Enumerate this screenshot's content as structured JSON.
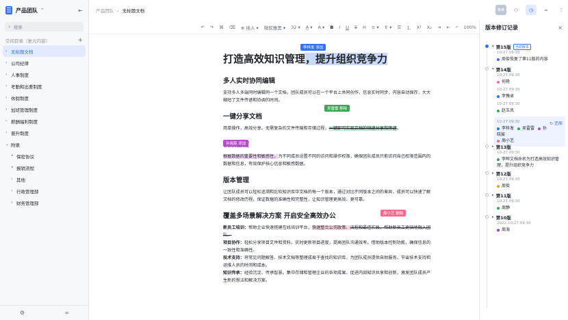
{
  "sidebar": {
    "team_name": "产品团队",
    "search_placeholder": "搜索",
    "section_title": "空间目录（复元内容）",
    "items": [
      {
        "label": "无标题文档",
        "active": true,
        "arrow": "›"
      },
      {
        "label": "公司纪律",
        "arrow": "›"
      },
      {
        "label": "人事制度",
        "arrow": "›"
      },
      {
        "label": "考勤和出差制度",
        "arrow": "›"
      },
      {
        "label": "休假制度",
        "arrow": "›"
      },
      {
        "label": "加班管理制度",
        "arrow": "›"
      },
      {
        "label": "薪酬福利制度",
        "arrow": "›"
      },
      {
        "label": "晋升制度",
        "arrow": "›"
      },
      {
        "label": "附录",
        "arrow": "⌄"
      },
      {
        "label": "保密协议",
        "child": true,
        "arrow": "•"
      },
      {
        "label": "报销流程",
        "child": true,
        "arrow": "•"
      },
      {
        "label": "其他",
        "child": true,
        "arrow": "›"
      },
      {
        "label": "行政管理部",
        "child": true,
        "arrow": "›"
      },
      {
        "label": "财务管理部",
        "child": true,
        "arrow": "›"
      }
    ]
  },
  "topbar": {
    "crumb_parent": "产品团队",
    "crumb_sep": "›",
    "crumb_current": "无标题文档",
    "avatar_text": "某某"
  },
  "toolbar": {
    "insert": "插入",
    "font": "微软雅黑",
    "size": "32",
    "zoom": "100%"
  },
  "doc": {
    "title_plain": "打造高效知识管理",
    "title_highlight": "，提升组织竞争力",
    "tag1": "李梓发 添加",
    "s1_title": "多人实时协同编辑",
    "s1_body": "支持多人多端同时编辑同一个文档，团队成员可以在一个平台上共同创作，信息实时同步，内容自动保存，大大缩短了文件传递和协调的时间。",
    "s2_title": "一键分享文档",
    "s2_body_a": "简单操作，高效分享。无需复杂的文件传输和存储过程，",
    "s2_body_hl": "一键即可实现文档的快速分享和传递",
    "s2_body_b": "。",
    "tag2": "吴雷雷 删除",
    "s3_title": "权限管控",
    "tag3": "孙晓宸 添加",
    "s3_body_hl": "根据数据的重要性和敏感性，",
    "s3_body": "为不同成员设置不同的访问和操作权限，确保团队成员只能访问自己权限范围内的数据和信息，有效保护核心信息和敏感数据。",
    "s4_title": "版本管理",
    "s4_body": "让团队成员可以轻松追溯和比较知识库中文档的每一个版本，通过对比不同版本之间的差异，成员可以快速了解文档的修改历程，保证数据的准确性和完整性，让知识管理更高效、更可靠。",
    "s5_title": "覆盖多场景解决方案 开启安全高效办公",
    "tag4": "周小艺 删除",
    "p1_label": "新员工培训：",
    "p1_a": "帮助企业快速搭建在线培训平台，",
    "p1_hl": "快速整合公司政策、",
    "p1_b": "流程和最佳实践，帮助新员工更快地融入团队。",
    "p2_label": "项目协作：",
    "p2": "轻松分享项目文件和资料，实时更新项目进度，提高团队沟通效率。借助版本控制功能，确保信息的一致性和准确性。",
    "p3_label": "技术支持：",
    "p3": "将常见问题解答、技术文档等整理成易于查找的知识库，为团队成员提供自助服务，节省技术支持和运维人员的时间和成本。",
    "p4_label": "知识传承：",
    "p4": "经验沉淀、传承智慧。集中存储和管理企业的各项成果，促进内部知识共享和创新，激发团队成员产生新的想法和解决方案。"
  },
  "panel": {
    "title": "版本修订记录",
    "current_badge": "当前版本",
    "restore": "还原",
    "versions": [
      {
        "title": "第15版",
        "date": "10-27 09:30",
        "user": "周俊恢复了第11版的内容",
        "color": "#3370ff"
      },
      {
        "title": "第14版",
        "date": "10-27 09:30",
        "user": "何艳",
        "color": "#f36a8f"
      },
      {
        "sub_date_1": "10-27 09:30",
        "sub_user_1": "李豫卓",
        "color1": "#3370ff",
        "sub_date_2": "10-27 09:30",
        "sub_user_2": "赵玉凤",
        "color2": "#34a853",
        "sub_date_3": "10-27 09:30",
        "u3a": "李梓发",
        "u3b": "吴雷雷",
        "u3c": "孙晓宸",
        "u3d": "周小艺"
      },
      {
        "title": "第13版",
        "date": "10-27 09:30",
        "user": "李晔文档命名为打造高效知识管理，提升组织竞争力",
        "color": "#34a853"
      },
      {
        "title": "第12版",
        "date": "10-27 09:30",
        "user": "周俊",
        "color": "#f59a23"
      },
      {
        "title": "第11版",
        "date": "10-27 09:30",
        "user": "周静",
        "color": "#34a853"
      },
      {
        "title": "第10版",
        "date": "2022-10-27 09:30",
        "user": "周海",
        "color": "#7b4fc5"
      }
    ]
  },
  "colors": {
    "accent": "#3370ff"
  }
}
